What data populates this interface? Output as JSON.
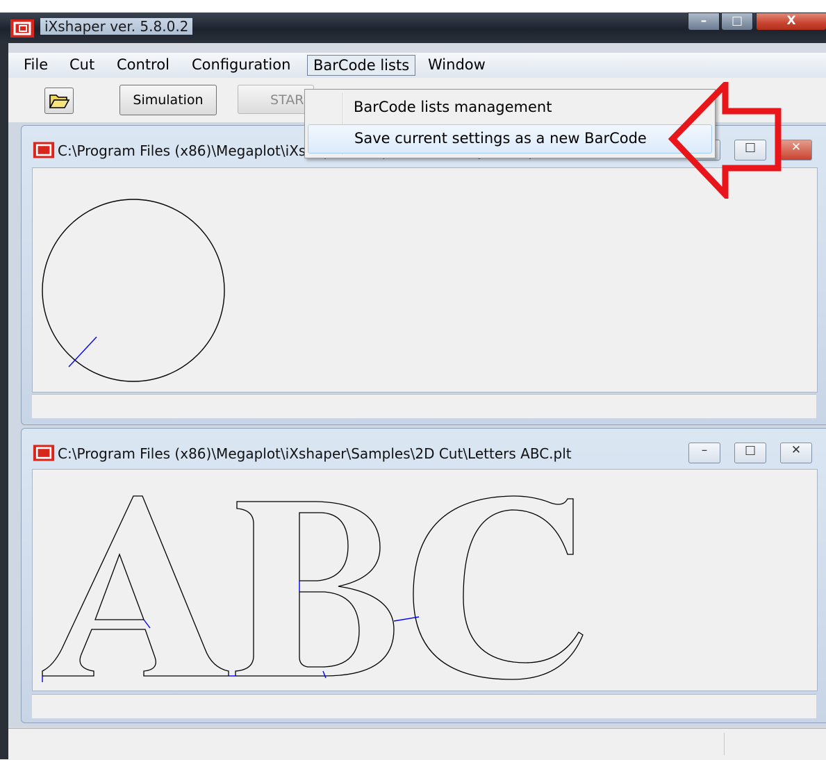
{
  "app": {
    "title": "iXshaper   ver. 5.8.0.2",
    "window_controls": {
      "minimize": "–",
      "maximize": "□",
      "close": "X"
    }
  },
  "menubar": {
    "items": [
      "File",
      "Cut",
      "Control",
      "Configuration",
      "BarCode lists",
      "Window"
    ]
  },
  "toolbar": {
    "open_icon": "folder-open-icon",
    "simulation_label": "Simulation",
    "start_label": "STAR"
  },
  "dropdown": {
    "items": [
      "BarCode lists management",
      "Save current settings as a new BarCode"
    ],
    "highlighted_index": 1
  },
  "windows": [
    {
      "title": "C:\\Program Files (x86)\\Megaplot\\iXshaper\\Samples\\2D Cut\\Cylinder.plt"
    },
    {
      "title": "C:\\Program Files (x86)\\Megaplot\\iXshaper\\Samples\\2D Cut\\Letters ABC.plt"
    }
  ],
  "colors": {
    "cut_path": "#000000",
    "travel_path": "#0000ff",
    "annotation_arrow": "#e8151b",
    "app_icon": "#d9261c"
  }
}
